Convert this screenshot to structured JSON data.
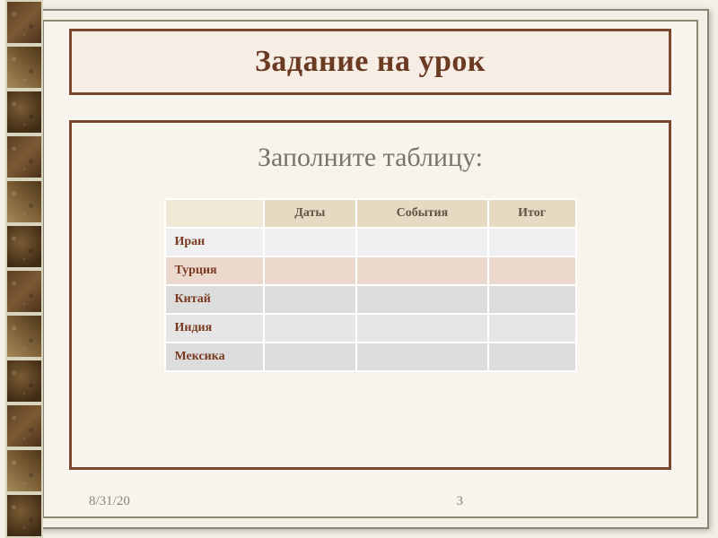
{
  "title": "Задание на урок",
  "subtitle": "Заполните таблицу:",
  "table": {
    "headers": [
      "Даты",
      "События",
      "Итог"
    ],
    "rows": [
      "Иран",
      "Турция",
      "Китай",
      "Индия",
      "Мексика"
    ]
  },
  "footer": {
    "date": "8/31/20",
    "page": "3"
  }
}
